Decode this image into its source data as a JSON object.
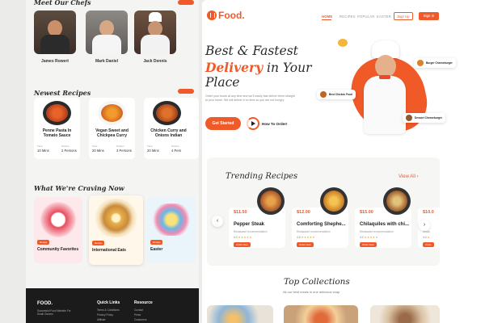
{
  "left": {
    "chefs_title": "Meet Our Chefs",
    "chefs": [
      {
        "name": "James Rowert"
      },
      {
        "name": "Mark Daniel"
      },
      {
        "name": "Jack Dennis"
      }
    ],
    "recipes_title": "Newest Recipes",
    "recipes": [
      {
        "name": "Penne Pasta In Tomato Sauce",
        "time_label": "Time",
        "time": "10 Mins",
        "portion_label": "Portion",
        "portion": "2 Persons"
      },
      {
        "name": "Vegan Sweet and Chickpea Curry",
        "time_label": "Time",
        "time": "20 Mins",
        "portion_label": "Portion",
        "portion": "3 Persons"
      },
      {
        "name": "Chicken Curry and Onions Indian",
        "time_label": "Time",
        "time": "20 Mins",
        "portion_label": "Portion",
        "portion": "4 Pers"
      }
    ],
    "craving_title": "What We're Craving Now",
    "craving": [
      {
        "tag": "Recipe",
        "label": "Community Favorites"
      },
      {
        "tag": "Recipe",
        "label": "International Eats"
      },
      {
        "tag": "Recipe",
        "label": "Easter"
      }
    ],
    "footer": {
      "logo": "FOOD.",
      "tagline": "Successful Food Website For Small Owners",
      "quick_links_title": "Quick Links",
      "quick_links": [
        "Terms & Conditions",
        "Privacy Policy",
        "Affiliate"
      ],
      "resource_title": "Resource",
      "resources": [
        "Contact",
        "Press",
        "Customers"
      ]
    }
  },
  "header": {
    "logo": "Food.",
    "nav": [
      "HOME",
      "RECIPES",
      "POPULAR",
      "EASTER"
    ],
    "signup": "Sign Up",
    "signin": "Sign In"
  },
  "hero": {
    "line1": "Best & Fastest",
    "line2_highlight": "Delivery",
    "line2_rest": " in Your",
    "line3": "Place",
    "description": "Order your foods at any time and we'll easily fast deliver them straight to your home. We will deliver it on time so you are not hungry.",
    "start_button": "Get Started",
    "how_to_order": "How To Order!",
    "badges": [
      "Burger Cheeseburger",
      "Best Chicken Food",
      "Dessert Cheeseburger"
    ]
  },
  "trending": {
    "title": "Trending Recipes",
    "view_all": "View All",
    "prev_icon": "chevron-left-icon",
    "next_icon": "chevron-right-icon",
    "cards": [
      {
        "price": "$11.50",
        "name": "Pepper Steak",
        "sub": "Restaurant recommendation",
        "rating": "4.0",
        "stars": "★★★★★",
        "order": "Order Now"
      },
      {
        "price": "$12.00",
        "name": "Comforting Shephe...",
        "sub": "Restaurant recommendation",
        "rating": "4.5",
        "stars": "★★★★★",
        "order": "Order Now"
      },
      {
        "price": "$15.00",
        "name": "Chilaquiles with chi...",
        "sub": "Restaurant recommendation",
        "rating": "4.0",
        "stars": "★★★★★",
        "order": "Order Now"
      },
      {
        "price": "$10.0",
        "name": "Pe",
        "sub": "Resta",
        "rating": "4.0",
        "stars": "★",
        "order": "Order"
      }
    ]
  },
  "collections": {
    "title": "Top Collections",
    "subtitle": "All our best meals in one delicious snap"
  },
  "colors": {
    "accent": "#f05a28",
    "dark": "#1b1b1b",
    "star": "#f5a623"
  }
}
